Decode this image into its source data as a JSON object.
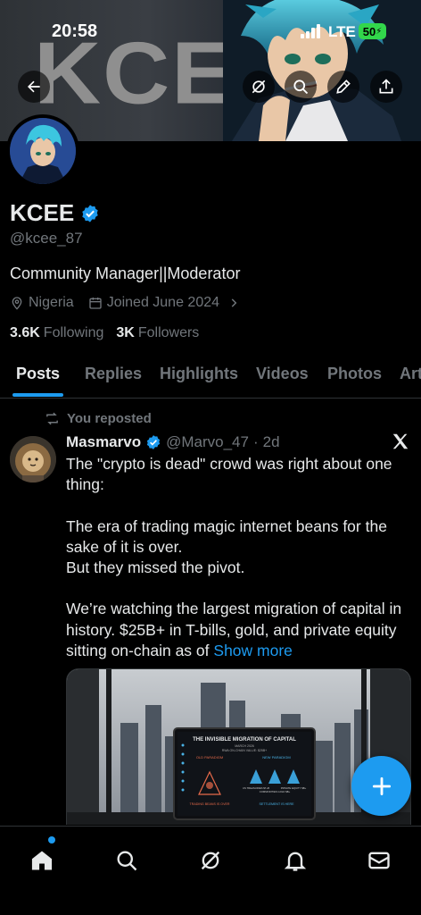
{
  "status_bar": {
    "time": "20:58",
    "network": "LTE",
    "battery": "50"
  },
  "banner": {
    "text": "KCEE"
  },
  "profile": {
    "name": "KCEE",
    "handle": "@kcee_87",
    "bio": "Community Manager||Moderator",
    "location": "Nigeria",
    "joined": "Joined June 2024",
    "following_count": "3.6K",
    "following_label": "Following",
    "followers_count": "3K",
    "followers_label": "Followers",
    "verified_color": "#1d9bf0"
  },
  "tabs": [
    {
      "label": "Posts"
    },
    {
      "label": "Replies"
    },
    {
      "label": "Highlights"
    },
    {
      "label": "Videos"
    },
    {
      "label": "Photos"
    },
    {
      "label": "Articles"
    }
  ],
  "post": {
    "repost_label": "You reposted",
    "author": "Masmarvo",
    "handle": "@Marvo_47",
    "separator": "·",
    "time": "2d",
    "paragraphs": [
      "The \"crypto is dead\" crowd was right about one thing:",
      "The era of trading magic internet beans for the sake of it is over.\nBut they missed the pivot.",
      "We’re watching the largest migration of capital in history. $25B+ in T-bills, gold, and private equity sitting on-chain as of"
    ],
    "show_more": "Show more",
    "media": {
      "title": "THE INVISIBLE MIGRATION OF CAPITAL",
      "subtitle_line1": "MARCH 2026",
      "subtitle_line2": "RWA ON-CHAIN VALUE: $25B+",
      "left_heading": "OLD PARADIGM",
      "right_heading": "NEW PARADIGM",
      "right_items": [
        "US TREASURIES $T+B",
        "COMMODITIES GOLD $B+",
        "PRIVATE EQUITY $B+"
      ],
      "left_footer": "TRADING BEANS IS OVER",
      "right_footer": "SETTLEMENT IS HERE"
    }
  },
  "accent_color": "#1d9bf0",
  "icons": {
    "back": "arrow-left-icon",
    "grok": "grok-icon",
    "search": "search-icon",
    "edit": "pencil-icon",
    "share": "share-icon",
    "verified": "verified-badge-icon",
    "location": "location-pin-icon",
    "calendar": "calendar-icon",
    "chevron": "chevron-right-icon",
    "repost": "repost-icon",
    "x_logo": "x-logo-icon",
    "compose": "plus-icon",
    "nav_home": "home-icon",
    "nav_search": "search-icon",
    "nav_grok": "grok-icon",
    "nav_notifications": "bell-icon",
    "nav_messages": "mail-icon"
  }
}
